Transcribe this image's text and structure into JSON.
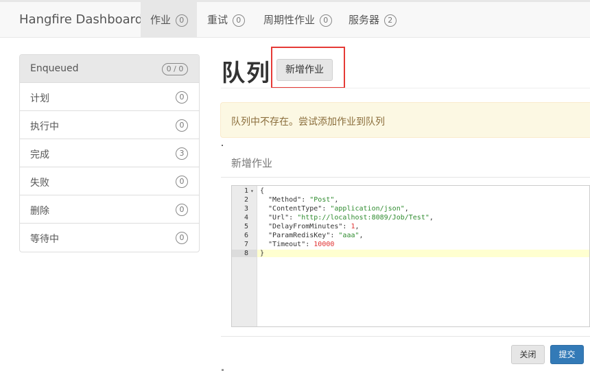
{
  "navbar": {
    "brand": "Hangfire Dashboard",
    "tabs": [
      {
        "label": "作业",
        "count": "0",
        "active": true
      },
      {
        "label": "重试",
        "count": "0"
      },
      {
        "label": "周期性作业",
        "count": "0"
      },
      {
        "label": "服务器",
        "count": "2"
      }
    ]
  },
  "sidebar": {
    "items": [
      {
        "label": "Enqueued",
        "count": "0 / 0",
        "active": true
      },
      {
        "label": "计划",
        "count": "0"
      },
      {
        "label": "执行中",
        "count": "0"
      },
      {
        "label": "完成",
        "count": "3"
      },
      {
        "label": "失败",
        "count": "0"
      },
      {
        "label": "删除",
        "count": "0"
      },
      {
        "label": "等待中",
        "count": "0"
      }
    ]
  },
  "main": {
    "title": "队列",
    "add_button": "新增作业",
    "alert": "队列中不存在。尝试添加作业到队列",
    "modal_title": "新增作业",
    "editor": {
      "line_numbers": [
        "1",
        "2",
        "3",
        "4",
        "5",
        "6",
        "7",
        "8"
      ],
      "lines": [
        "{",
        "  \"Method\": \"Post\",",
        "  \"ContentType\": \"application/json\",",
        "  \"Url\": \"http://localhost:8089/Job/Test\",",
        "  \"DelayFromMinutes\": 1,",
        "  \"ParamRedisKey\": \"aaa\",",
        "  \"Timeout\": 10000",
        "}"
      ]
    },
    "close_button": "关闭",
    "submit_button": "提交"
  },
  "colors": {
    "accent": "#337ab7",
    "highlight": "#e53935",
    "alert_bg": "#fcf8e3"
  }
}
